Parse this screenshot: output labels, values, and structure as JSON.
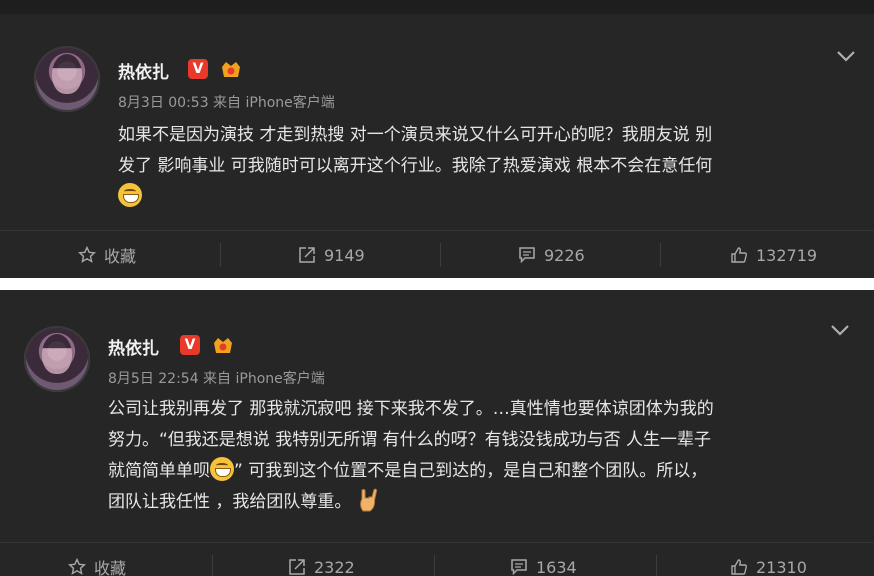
{
  "posts": [
    {
      "user": "热依扎",
      "verified_badge": "V",
      "meta": "8月3日 00:53 来自 iPhone客户端",
      "content_lines": [
        "如果不是因为演技 才走到热搜 对一个演员来说又什么可开心的呢？我朋友说 别",
        "发了 影响事业 可我随时可以离开这个行业。我除了热爱演戏 根本不会在意任何"
      ],
      "actions": {
        "favorite": "收藏",
        "repost": "9149",
        "comment": "9226",
        "like": "132719"
      }
    },
    {
      "user": "热依扎",
      "verified_badge": "V",
      "meta": "8月5日 22:54 来自 iPhone客户端",
      "content_lines": [
        "公司让我别再发了 那我就沉寂吧 接下来我不发了。…真性情也要体谅团体为我的",
        "努力。“但我还是想说 我特别无所谓 有什么的呀？有钱没钱成功与否 人生一辈子",
        "就简简单单呗",
        "” 可我到这个位置不是自己到达的，是自己和整个团队。所以，",
        "团队让我任性 ，我给团队尊重。"
      ],
      "actions": {
        "favorite": "收藏",
        "repost": "2322",
        "comment": "1634",
        "like": "21310"
      }
    }
  ],
  "icons": {
    "favorite": "star-icon",
    "repost": "share-icon",
    "comment": "comment-icon",
    "like": "thumbs-up-icon",
    "menu": "chevron-down-icon"
  },
  "colors": {
    "verified": "#e8392b",
    "card_bg": "#262626",
    "text": "#e6e6e6",
    "meta": "#9a9a9a"
  }
}
